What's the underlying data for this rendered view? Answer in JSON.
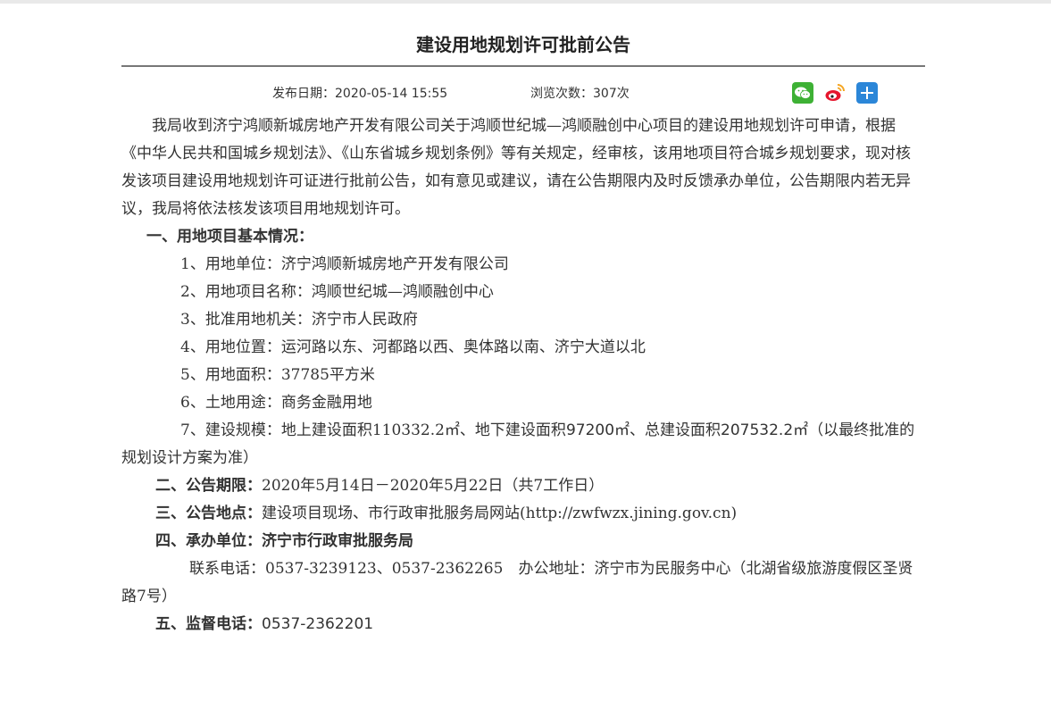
{
  "article": {
    "title": "建设用地规划许可批前公告",
    "publish_label": "发布日期：",
    "publish_date": "2020-05-14 15:55",
    "views_label": "浏览次数：",
    "views_count": "307次"
  },
  "share": {
    "icons": [
      "wechat-icon",
      "weibo-icon",
      "share-more-icon"
    ],
    "colors": {
      "wechat": "#3eb135",
      "weibo_red": "#e6162d",
      "weibo_yellow": "#f5a623",
      "more": "#2b86d8"
    }
  },
  "body": {
    "intro": "我局收到济宁鸿顺新城房地产开发有限公司关于鸿顺世纪城—鸿顺融创中心项目的建设用地规划许可申请，根据《中华人民共和国城乡规划法》、《山东省城乡规划条例》等有关规定，经审核，该用地项目符合城乡规划要求，现对核发该项目建设用地规划许可证进行批前公告，如有意见或建议，请在公告期限内及时反馈承办单位，公告期限内若无异议，我局将依法核发该项目用地规划许可。",
    "section1_heading": "一、用地项目基本情况：",
    "items": [
      "1、用地单位：济宁鸿顺新城房地产开发有限公司",
      "2、用地项目名称：鸿顺世纪城—鸿顺融创中心",
      "3、批准用地机关：济宁市人民政府",
      "4、用地位置：运河路以东、河都路以西、奥体路以南、济宁大道以北",
      "5、用地面积：37785平方米",
      "6、土地用途：商务金融用地"
    ],
    "item7_a": "7、建设规模：地上建设面积110332.2㎡、地下建设面积",
    "item7_b": "97200㎡",
    "item7_c": "、总建设面积",
    "item7_d": "207532.2㎡",
    "item7_e": "（以最终批准的规划设计方案为准）",
    "section2_label": "二、公告期限：",
    "section2_value": "2020年5月14日－2020年5月22日（共7工作日）",
    "section3_label": "三、公告地点：",
    "section3_value": "建设项目现场、市行政审批服务局网站(http://zwfwzx.jining.gov.cn)",
    "section4_heading": "四、承办单位：济宁市行政审批服务局",
    "contact": "联系电话：0537-3239123、0537-2362265　办公地址：济宁市为民服务中心（北湖省级旅游度假区圣贤路7号）",
    "section5_label": "五、监督电话：",
    "section5_value": "0537-2362201"
  }
}
